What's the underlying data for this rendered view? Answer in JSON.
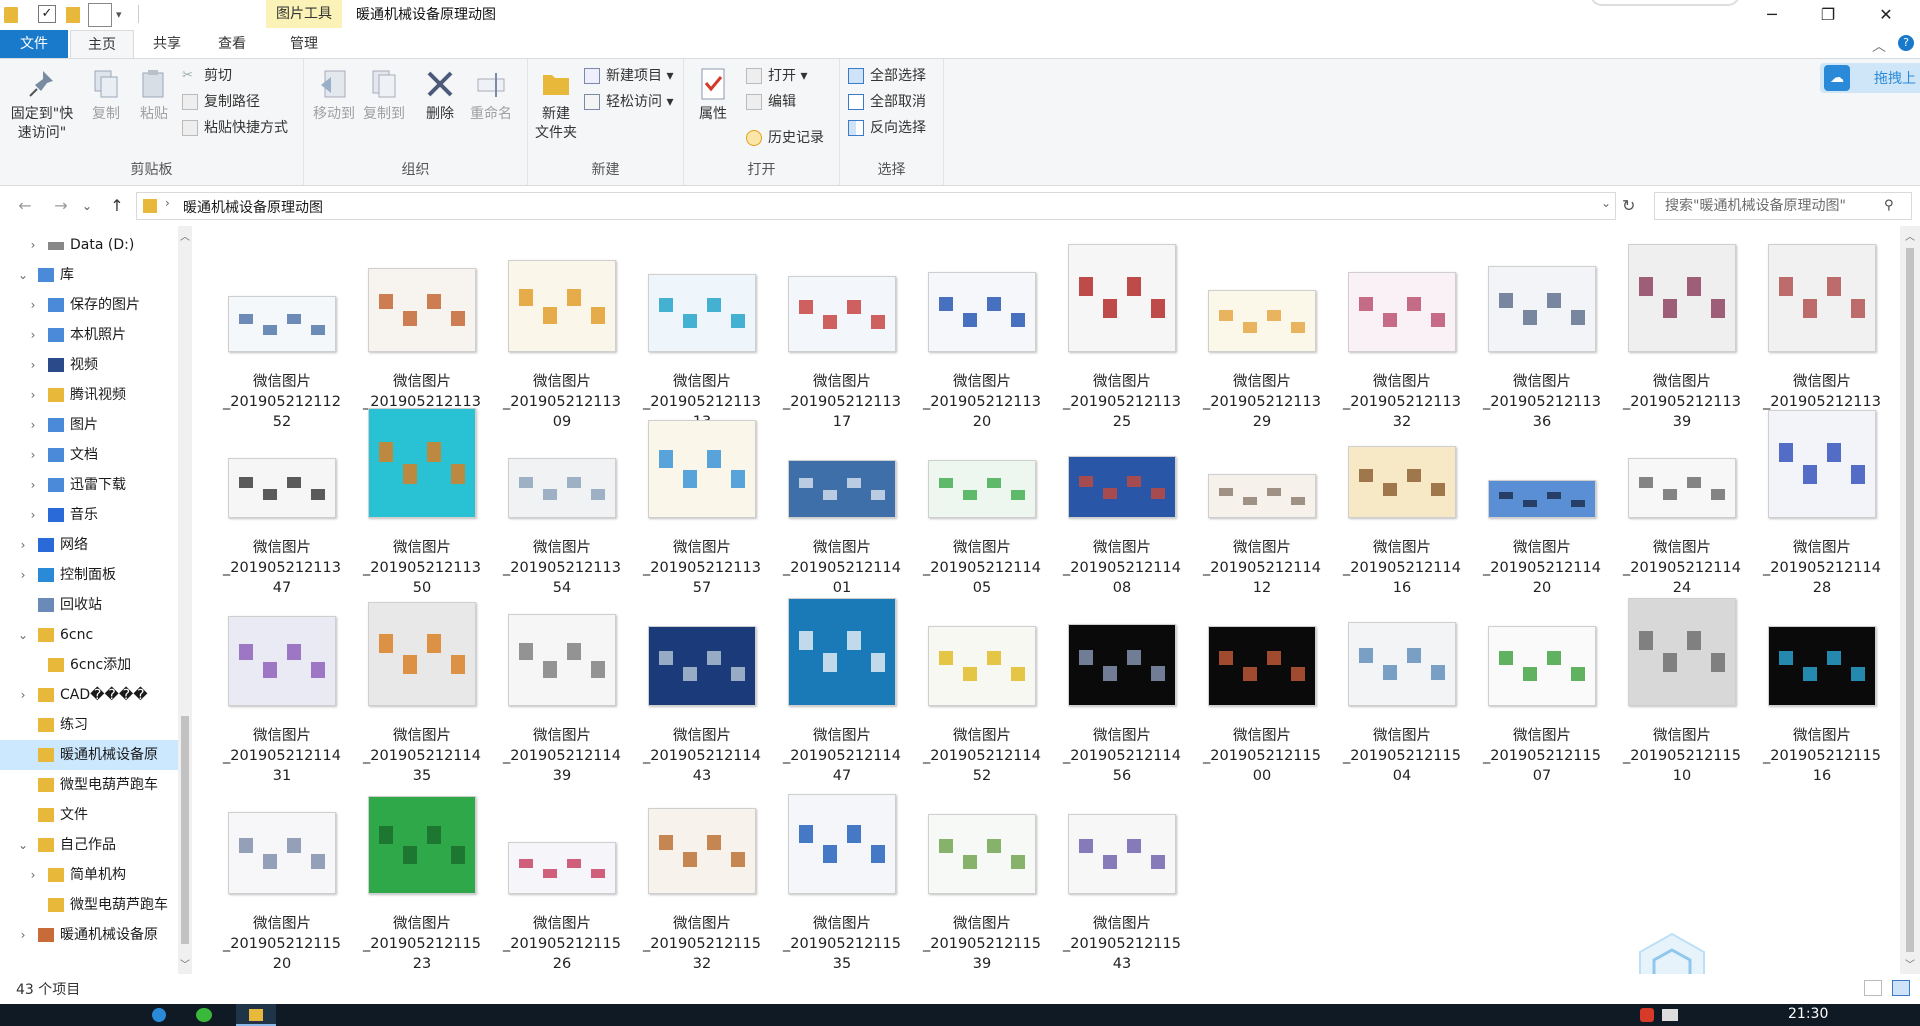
{
  "window": {
    "title": "暖通机械设备原理动图",
    "context_tab": "图片工具"
  },
  "tabs": {
    "file": "文件",
    "home": "主页",
    "share": "共享",
    "view": "查看",
    "manage": "管理"
  },
  "ribbon": {
    "clipboard": {
      "label": "剪贴板",
      "pin": "固定到\"快速访问\"",
      "copy": "复制",
      "paste": "粘贴",
      "cut": "剪切",
      "copy_path": "复制路径",
      "paste_shortcut": "粘贴快捷方式"
    },
    "organize": {
      "label": "组织",
      "move_to": "移动到",
      "copy_to": "复制到",
      "delete": "删除",
      "rename": "重命名"
    },
    "new": {
      "label": "新建",
      "new_folder": "新建\n文件夹",
      "new_item": "新建项目",
      "easy_access": "轻松访问"
    },
    "open": {
      "label": "打开",
      "properties": "属性",
      "open": "打开",
      "edit": "编辑",
      "history": "历史记录"
    },
    "select": {
      "label": "选择",
      "select_all": "全部选择",
      "select_none": "全部取消",
      "invert": "反向选择"
    },
    "cloud": "拖拽上"
  },
  "address": {
    "path": "暖通机械设备原理动图",
    "search_placeholder": "搜索\"暖通机械设备原理动图\""
  },
  "sidebar": [
    {
      "label": "Data (D:)",
      "icon": "drive-icon",
      "indent": 1,
      "exp": "›"
    },
    {
      "label": "库",
      "icon": "library-icon",
      "indent": 0,
      "exp": "⌄"
    },
    {
      "label": "保存的图片",
      "icon": "library-icon",
      "indent": 1,
      "exp": "›"
    },
    {
      "label": "本机照片",
      "icon": "library-icon",
      "indent": 1,
      "exp": "›"
    },
    {
      "label": "视频",
      "icon": "video-icon",
      "indent": 1,
      "exp": "›"
    },
    {
      "label": "腾讯视频",
      "icon": "folder-icon",
      "indent": 1,
      "exp": "›"
    },
    {
      "label": "图片",
      "icon": "library-icon",
      "indent": 1,
      "exp": "›"
    },
    {
      "label": "文档",
      "icon": "library-icon",
      "indent": 1,
      "exp": "›"
    },
    {
      "label": "迅雷下载",
      "icon": "library-icon",
      "indent": 1,
      "exp": "›"
    },
    {
      "label": "音乐",
      "icon": "music-icon",
      "indent": 1,
      "exp": "›"
    },
    {
      "label": "网络",
      "icon": "network-icon",
      "indent": 0,
      "exp": "›"
    },
    {
      "label": "控制面板",
      "icon": "control-panel-icon",
      "indent": 0,
      "exp": "›"
    },
    {
      "label": "回收站",
      "icon": "recycle-bin-icon",
      "indent": 0,
      "exp": ""
    },
    {
      "label": "6cnc",
      "icon": "folder-icon",
      "indent": 0,
      "exp": "⌄"
    },
    {
      "label": "6cnc添加",
      "icon": "folder-icon",
      "indent": 1,
      "exp": ""
    },
    {
      "label": "CAD����",
      "icon": "folder-icon",
      "indent": 0,
      "exp": "›"
    },
    {
      "label": "练习",
      "icon": "folder-icon",
      "indent": 0,
      "exp": ""
    },
    {
      "label": "暖通机械设备原",
      "icon": "folder-icon",
      "indent": 0,
      "exp": "",
      "selected": true
    },
    {
      "label": "微型电葫芦跑车",
      "icon": "folder-icon",
      "indent": 0,
      "exp": ""
    },
    {
      "label": "文件",
      "icon": "folder-icon",
      "indent": 0,
      "exp": ""
    },
    {
      "label": "自己作品",
      "icon": "folder-icon",
      "indent": 0,
      "exp": "⌄"
    },
    {
      "label": "简单机构",
      "icon": "folder-icon",
      "indent": 1,
      "exp": "›"
    },
    {
      "label": "微型电葫芦跑车",
      "icon": "folder-icon",
      "indent": 1,
      "exp": ""
    },
    {
      "label": "暖通机械设备原",
      "icon": "picture-folder-icon",
      "indent": 0,
      "exp": "›"
    }
  ],
  "files": [
    {
      "name": "微信图片_2019052121125 2",
      "line2": "_20190521211252",
      "h": 56,
      "bg": "#f4f8fb",
      "acc": "#4a6fa5"
    },
    {
      "name": "",
      "line2": "_20190521211302",
      "h": 84,
      "bg": "#f7f3ee",
      "acc": "#c0602a"
    },
    {
      "name": "",
      "line2": "_20190521211309",
      "h": 92,
      "bg": "#fbf6ea",
      "acc": "#e29a22"
    },
    {
      "name": "",
      "line2": "_20190521211313",
      "h": 78,
      "bg": "#eef6fb",
      "acc": "#1aa0c8"
    },
    {
      "name": "",
      "line2": "_20190521211317",
      "h": 76,
      "bg": "#f3f7fb",
      "acc": "#c53a3a"
    },
    {
      "name": "",
      "line2": "_20190521211320",
      "h": 80,
      "bg": "#f5f7fb",
      "acc": "#1b4fb0"
    },
    {
      "name": "",
      "line2": "_20190521211325",
      "h": 108,
      "bg": "#f6f6f6",
      "acc": "#b21f1f"
    },
    {
      "name": "",
      "line2": "_20190521211329",
      "h": 62,
      "bg": "#fbf8ea",
      "acc": "#e6a13a"
    },
    {
      "name": "",
      "line2": "_20190521211332",
      "h": 80,
      "bg": "#f9f1f5",
      "acc": "#b84a6a"
    },
    {
      "name": "",
      "line2": "_20190521211336",
      "h": 86,
      "bg": "#f2f4f8",
      "acc": "#5a6a8a"
    },
    {
      "name": "",
      "line2": "_20190521211339",
      "h": 108,
      "bg": "#efefef",
      "acc": "#8a3a5a"
    },
    {
      "name": "",
      "line2": "_20190521211343",
      "h": 108,
      "bg": "#f1f1f1",
      "acc": "#b04a4a"
    },
    {
      "name": "",
      "line2": "_20190521211347",
      "h": 60,
      "bg": "#f6f6f6",
      "acc": "#333333"
    },
    {
      "name": "",
      "line2": "_20190521211350",
      "h": 110,
      "bg": "#29c1d4",
      "acc": "#e07c1a"
    },
    {
      "name": "",
      "line2": "_20190521211354",
      "h": 60,
      "bg": "#f1f2f4",
      "acc": "#8aa0b8"
    },
    {
      "name": "",
      "line2": "_20190521211357",
      "h": 98,
      "bg": "#fbf6ea",
      "acc": "#2f8fd6"
    },
    {
      "name": "",
      "line2": "_20190521211401",
      "h": 58,
      "bg": "#3f6fa8",
      "acc": "#d8e3ef"
    },
    {
      "name": "",
      "line2": "_20190521211405",
      "h": 58,
      "bg": "#eef6f0",
      "acc": "#3aaa4a"
    },
    {
      "name": "",
      "line2": "_20190521211408",
      "h": 62,
      "bg": "#2a56a8",
      "acc": "#c64a3a"
    },
    {
      "name": "",
      "line2": "_20190521211412",
      "h": 44,
      "bg": "#f6f1ea",
      "acc": "#8a7a6a"
    },
    {
      "name": "",
      "line2": "_20190521211416",
      "h": 72,
      "bg": "#f7e8c6",
      "acc": "#8a5a2a"
    },
    {
      "name": "",
      "line2": "_20190521211420",
      "h": 38,
      "bg": "#5a8fd6",
      "acc": "#1a2a4a"
    },
    {
      "name": "",
      "line2": "_20190521211424",
      "h": 60,
      "bg": "#f7f7f7",
      "acc": "#666666"
    },
    {
      "name": "",
      "line2": "_20190521211428",
      "h": 108,
      "bg": "#f2f4fa",
      "acc": "#2a4ab8"
    },
    {
      "name": "",
      "line2": "_20190521211431",
      "h": 90,
      "bg": "#eaeaf5",
      "acc": "#8a5ab8"
    },
    {
      "name": "",
      "line2": "_20190521211435",
      "h": 104,
      "bg": "#e8e8e8",
      "acc": "#d87a1a"
    },
    {
      "name": "",
      "line2": "_20190521211439",
      "h": 92,
      "bg": "#f6f6f6",
      "acc": "#7a7a7a"
    },
    {
      "name": "",
      "line2": "_20190521211443",
      "h": 80,
      "bg": "#1a3a7a",
      "acc": "#b8c8d8"
    },
    {
      "name": "",
      "line2": "_20190521211447",
      "h": 108,
      "bg": "#1a7ab8",
      "acc": "#eaf2f8"
    },
    {
      "name": "",
      "line2": "_20190521211452",
      "h": 80,
      "bg": "#f8f8f2",
      "acc": "#e0b81a"
    },
    {
      "name": "",
      "line2": "_20190521211456",
      "h": 82,
      "bg": "#0a0a0a",
      "acc": "#8a9ab8"
    },
    {
      "name": "",
      "line2": "_20190521211500",
      "h": 80,
      "bg": "#0a0a0a",
      "acc": "#c65a3a"
    },
    {
      "name": "",
      "line2": "_20190521211504",
      "h": 84,
      "bg": "#f2f4f6",
      "acc": "#5a8ab8"
    },
    {
      "name": "",
      "line2": "_20190521211507",
      "h": 80,
      "bg": "#fafafa",
      "acc": "#3aa03a"
    },
    {
      "name": "",
      "line2": "_20190521211510",
      "h": 108,
      "bg": "#d8d8d8",
      "acc": "#6a6a6a"
    },
    {
      "name": "",
      "line2": "_20190521211516",
      "h": 80,
      "bg": "#0a0a0a",
      "acc": "#2aa8d8"
    },
    {
      "name": "",
      "line2": "_20190521211520",
      "h": 82,
      "bg": "#f7f7f9",
      "acc": "#7a8aa8"
    },
    {
      "name": "",
      "line2": "_20190521211523",
      "h": 98,
      "bg": "#2fa84a",
      "acc": "#1a6a2a"
    },
    {
      "name": "",
      "line2": "_20190521211526",
      "h": 52,
      "bg": "#f6f6fa",
      "acc": "#c53a5a"
    },
    {
      "name": "",
      "line2": "_20190521211532",
      "h": 86,
      "bg": "#f7f3ec",
      "acc": "#b86a2a"
    },
    {
      "name": "",
      "line2": "_20190521211535",
      "h": 100,
      "bg": "#f4f6fa",
      "acc": "#1a5ab8"
    },
    {
      "name": "",
      "line2": "_20190521211539",
      "h": 80,
      "bg": "#f7f9f6",
      "acc": "#6aa04a"
    },
    {
      "name": "",
      "line2": "_20190521211543",
      "h": 80,
      "bg": "#f7f7f7",
      "acc": "#6a5aa8"
    }
  ],
  "file_caption": "微信图片",
  "status": {
    "count": "43 个项目"
  },
  "taskbar": {
    "clock": "21:30"
  }
}
